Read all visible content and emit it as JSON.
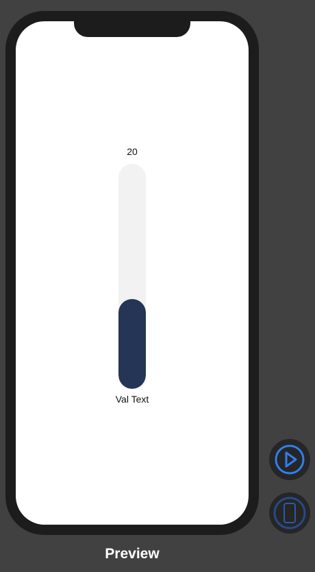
{
  "slider": {
    "value_text": "20",
    "caption": "Val Text",
    "fill_fraction": 0.4,
    "fill_color": "#253555",
    "track_color": "#f2f2f2"
  },
  "controls": {
    "play_icon": "play-circle-icon",
    "device_icon": "device-icon",
    "accent": "#2f7ff0"
  },
  "footer": {
    "label": "Preview"
  }
}
